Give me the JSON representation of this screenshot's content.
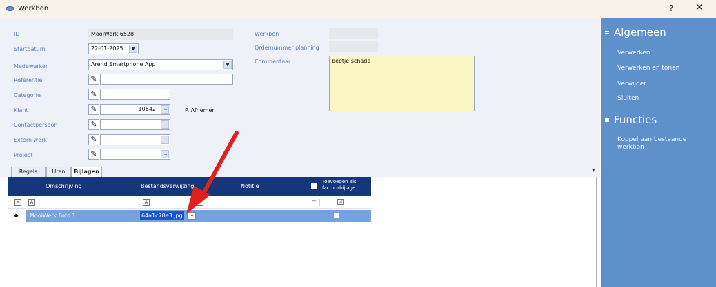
{
  "window": {
    "title": "Werkbon",
    "help_label": "?",
    "close_label": "✕",
    "icon": "app-icon"
  },
  "form": {
    "id": {
      "label": "ID",
      "value": "MooiWerk 6528"
    },
    "startdatum": {
      "label": "Startdatum",
      "value": "22-01-2025"
    },
    "medewerker": {
      "label": "Medewerker",
      "value": "Arend Smartphone App"
    },
    "referentie": {
      "label": "Referentie",
      "value": ""
    },
    "categorie": {
      "label": "Categorie",
      "value": ""
    },
    "klant": {
      "label": "Klant",
      "value": "10642",
      "name": "P. Afnemer"
    },
    "contactpersoon": {
      "label": "Contactpersoon",
      "value": ""
    },
    "extern_werk": {
      "label": "Extern werk",
      "value": ""
    },
    "project": {
      "label": "Project",
      "value": ""
    },
    "werkbon": {
      "label": "Werkbon",
      "value": ""
    },
    "ordernummer": {
      "label": "Ordernummer planning",
      "value": ""
    },
    "commentaar": {
      "label": "Commentaar",
      "value": "beetje schade"
    },
    "ellipsis": "...",
    "dropdown_glyph": "▼",
    "edit_glyph": "✎"
  },
  "tabs": [
    {
      "label": "Regels",
      "active": false
    },
    {
      "label": "Uren",
      "active": false
    },
    {
      "label": "Bijlagen",
      "active": true
    }
  ],
  "grid": {
    "columns": [
      "Omschrijving",
      "Bestandsverwijzing",
      "Notitie",
      "Toevoegen als factuurbijlage"
    ],
    "filter_eq": "=",
    "filter_check": "☑",
    "rows": [
      {
        "omschrijving": "MooiWerk Foto 1",
        "bestandsverwijzing": "64a1c78e3.jpg",
        "ellipsis": "...",
        "factuurbijlage": false
      }
    ]
  },
  "sidebar": {
    "sections": [
      {
        "title": "Algemeen",
        "actions": [
          "Verwerken",
          "Verwerken en tonen",
          "Verwijder",
          "Sluiten"
        ]
      },
      {
        "title": "Functies",
        "actions": [
          "Koppel aan bestaande werkbon"
        ]
      }
    ]
  },
  "colors": {
    "accent": "#5b7fc5",
    "sidebar": "#5e90cb",
    "grid_header": "#16367c",
    "selected_row": "#76a3df",
    "annotation_arrow": "#e0201b"
  }
}
